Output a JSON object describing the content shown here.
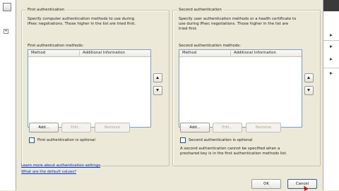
{
  "first": {
    "title": "First authentication",
    "description_line1": "Specify computer authentication methods to use during",
    "description_line2": "IPsec negotiations.  Those higher in the list are tried first.",
    "list_label": "First authentication methods:",
    "columns": [
      "Method",
      "Additional Information"
    ],
    "buttons": {
      "add": "Add...",
      "edit": "Edit...",
      "remove": "Remove"
    },
    "optional_label": "First authentication is optional"
  },
  "second": {
    "title": "Second authentication",
    "description_line1": "Specify user authentication methods or a health certificate to",
    "description_line2": "use during IPsec negotiations.  Those higher in the list are",
    "description_line3": "tried first.",
    "list_label": "Second authentication methods:",
    "columns": [
      "Method",
      "Additional Information"
    ],
    "buttons": {
      "add": "Add...",
      "edit": "Edit...",
      "remove": "Remove"
    },
    "optional_label": "Second authentication is optional",
    "note_line1": "A second authentication cannot be specified when a",
    "note_line2": "preshared key is in the first authentication methods list."
  },
  "links": {
    "learn_more": "Learn more about authentication settings",
    "defaults": "What are the default values?"
  },
  "footer": {
    "ok": "OK",
    "cancel": "Cancel"
  },
  "icons": {
    "move_up": "up-arrow-icon",
    "move_down": "down-arrow-icon"
  }
}
